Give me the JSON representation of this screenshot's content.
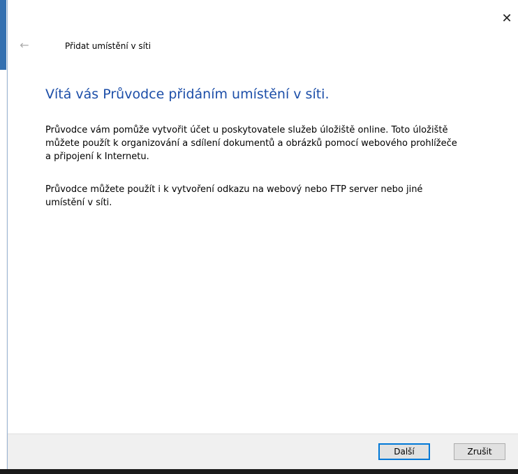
{
  "window": {
    "close_glyph": "✕",
    "back_glyph": "←",
    "title": "Přidat umístění v síti"
  },
  "main": {
    "heading": "Vítá vás Průvodce přidáním umístění v síti.",
    "paragraph1": "Průvodce vám pomůže vytvořit účet u poskytovatele služeb úložiště online. Toto úložiště můžete použít k organizování a sdílení dokumentů a obrázků pomocí webového prohlížeče a připojení k Internetu.",
    "paragraph2": "Průvodce můžete použít i k vytvoření odkazu na webový nebo FTP server nebo jiné umístění v síti."
  },
  "footer": {
    "next_label": "Další",
    "cancel_label": "Zrušit"
  },
  "colors": {
    "heading": "#1c4ea8",
    "primary_border": "#0078d7",
    "footer_bg": "#f0f0f0"
  },
  "icons": {
    "close": "close-icon",
    "back": "back-arrow-icon"
  }
}
